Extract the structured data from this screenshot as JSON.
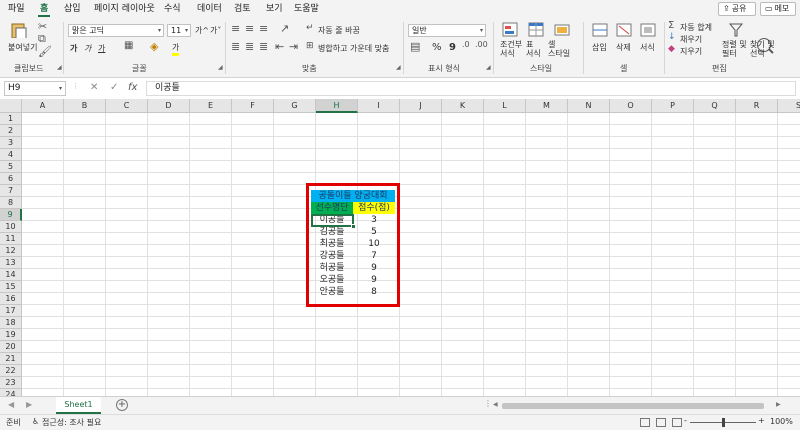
{
  "menu": {
    "tabs": [
      "파일",
      "홈",
      "삽입",
      "페이지 레이아웃",
      "수식",
      "데이터",
      "검토",
      "보기",
      "도움말"
    ],
    "active": "홈",
    "share_label": "공유",
    "memo_label": "메모"
  },
  "ribbon": {
    "clipboard": {
      "paste_label": "붙여넣기",
      "group_label": "클립보드"
    },
    "font": {
      "font_name": "맑은 고딕",
      "font_size": "11",
      "grow": "가^",
      "shrink": "가˅",
      "bold": "가",
      "italic": "가",
      "underline": "가",
      "font_color_glyph": "가",
      "group_label": "글꼴"
    },
    "alignment": {
      "wrap_text": "자동 줄 바꿈",
      "merge_center": "병합하고 가운데 맞춤",
      "group_label": "맞춤"
    },
    "number": {
      "format": "일반",
      "percent": "%",
      "comma": "9",
      "group_label": "표시 형식"
    },
    "styles": {
      "conditional_label": "조건부\n서식",
      "table_label": "표\n서식",
      "cell_style_label": "셀\n스타일",
      "group_label": "스타일"
    },
    "cells": {
      "insert_label": "삽입",
      "delete_label": "삭제",
      "format_label": "서식",
      "group_label": "셀"
    },
    "editing": {
      "autosum_label": "자동 합계",
      "fill_label": "채우기",
      "clear_label": "지우기",
      "sort_label": "정렬 및\n필터",
      "find_label": "찾기 및\n선택",
      "group_label": "편집"
    },
    "accent": "#217346"
  },
  "formula_bar": {
    "name_box": "H9",
    "cancel": "✕",
    "enter": "✓",
    "fx": "fx",
    "content": "이공들"
  },
  "sheet": {
    "columns": [
      "A",
      "B",
      "C",
      "D",
      "E",
      "F",
      "G",
      "H",
      "I",
      "J",
      "K",
      "L",
      "M",
      "N",
      "O",
      "P",
      "Q",
      "R",
      "S"
    ],
    "rows": [
      "1",
      "2",
      "3",
      "4",
      "5",
      "6",
      "7",
      "8",
      "9",
      "10",
      "11",
      "12",
      "13",
      "14",
      "15",
      "16",
      "17",
      "18",
      "19",
      "20",
      "21",
      "22",
      "23",
      "24"
    ],
    "selected_column": "H",
    "selected_row": "9",
    "title": "공돌이들 양궁대회",
    "header_name": "선수명단",
    "header_score": "점수(점)",
    "players": [
      {
        "name": "이공들",
        "score": "3"
      },
      {
        "name": "김공들",
        "score": "5"
      },
      {
        "name": "최공들",
        "score": "10"
      },
      {
        "name": "강공들",
        "score": "7"
      },
      {
        "name": "허공들",
        "score": "9"
      },
      {
        "name": "오공들",
        "score": "9"
      },
      {
        "name": "안공들",
        "score": "8"
      }
    ],
    "colors": {
      "title_bg": "#00b0f0",
      "name_header_bg": "#00b050",
      "score_header_bg": "#ffff00",
      "highlight_border": "#e00000"
    }
  },
  "tabs": {
    "sheet_name": "Sheet1",
    "add": "+",
    "dots": "⋮"
  },
  "status": {
    "ready": "준비",
    "accessibility": "접근성: 조사 필요",
    "zoom": "100%",
    "zoom_minus": "-",
    "zoom_plus": "+"
  }
}
